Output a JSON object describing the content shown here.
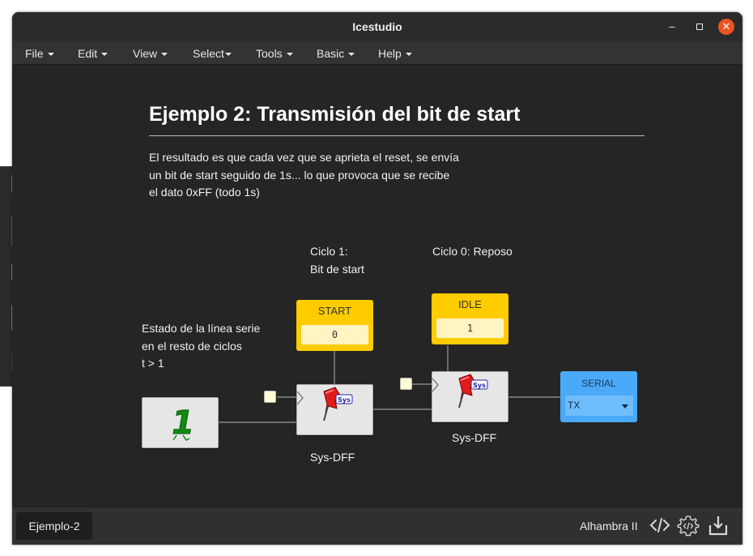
{
  "window": {
    "title": "Icestudio"
  },
  "menu": [
    {
      "label": "File"
    },
    {
      "label": "Edit"
    },
    {
      "label": "View"
    },
    {
      "label": "Select"
    },
    {
      "label": "Tools"
    },
    {
      "label": "Basic"
    },
    {
      "label": "Help"
    }
  ],
  "doc": {
    "heading": "Ejemplo 2: Transmisión del bit de start",
    "para_lines": [
      "El resultado es que cada vez que se aprieta el reset, se envía",
      "un bit de start seguido de 1s... lo que provoca que se recibe",
      "el dato 0xFF (todo 1s)"
    ],
    "note_cycle1": [
      "Ciclo 1:",
      "Bit de start"
    ],
    "note_cycle0": "Ciclo 0: Reposo",
    "note_line": [
      "Estado de la línea serie",
      "en el resto de ciclos",
      "t > 1"
    ]
  },
  "blocks": {
    "const_start": {
      "label": "START",
      "value": "0"
    },
    "const_idle": {
      "label": "IDLE",
      "value": "1"
    },
    "dff1": {
      "caption": "Sys-DFF",
      "badge": "Sys"
    },
    "dff2": {
      "caption": "Sys-DFF",
      "badge": "Sys"
    },
    "one": {
      "glyph": "1"
    },
    "serial": {
      "label": "SERIAL",
      "pin": "TX"
    }
  },
  "status": {
    "tab": "Ejemplo-2",
    "board": "Alhambra II"
  },
  "icons": {
    "code": "code-icon",
    "settings": "gear-code-icon",
    "download": "download-icon"
  },
  "colors": {
    "const_block": "#ffcc00",
    "serial_block": "#4aaaf9",
    "close_button": "#e95420"
  }
}
